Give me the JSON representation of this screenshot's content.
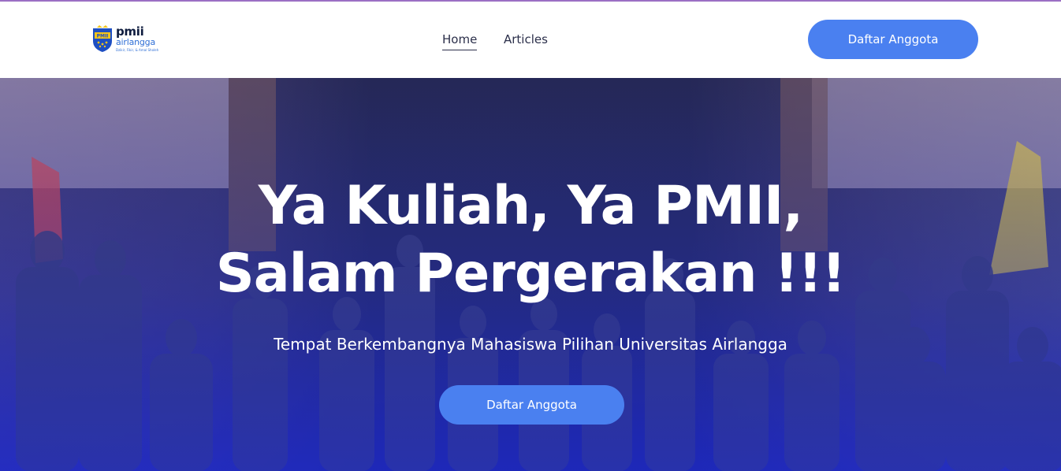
{
  "header": {
    "logo": {
      "brand_top": "pmii",
      "brand_bottom": "airlangga",
      "tagline": "Dzikir, Fikir, & Amal Sholeh",
      "emblem_text": "PMII"
    },
    "nav": [
      {
        "label": "Home",
        "active": true
      },
      {
        "label": "Articles",
        "active": false
      }
    ],
    "cta_label": "Daftar Anggota"
  },
  "hero": {
    "title_line1": "Ya Kuliah, Ya PMII,",
    "title_line2": "Salam Pergerakan !!!",
    "subtitle": "Tempat Berkembangnya Mahasiswa Pilihan Universitas Airlangga",
    "cta_label": "Daftar Anggota"
  },
  "colors": {
    "accent": "#4a80f0",
    "nav_text": "#2b2f4a",
    "overlay": "#2028a0",
    "top_border": "#9b6fc4"
  }
}
